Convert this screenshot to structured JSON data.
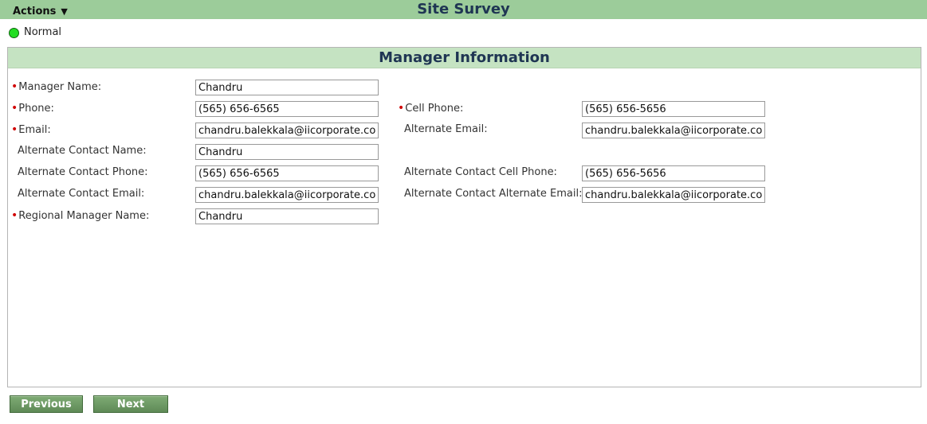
{
  "header": {
    "actions_label": "Actions",
    "actions_caret": "▼",
    "title": "Site Survey"
  },
  "status": {
    "label": "Normal",
    "color": "#22dd22"
  },
  "section": {
    "title": "Manager Information"
  },
  "fields": {
    "manager_name": {
      "label": "Manager Name:",
      "value": "Chandru",
      "required": true
    },
    "phone": {
      "label": "Phone:",
      "value": "(565) 656-6565",
      "required": true
    },
    "cell_phone": {
      "label": "Cell Phone:",
      "value": "(565) 656-5656",
      "required": true
    },
    "email": {
      "label": "Email:",
      "value": "chandru.balekkala@iicorporate.com",
      "required": true
    },
    "alternate_email": {
      "label": "Alternate Email:",
      "value": "chandru.balekkala@iicorporate.com",
      "required": false
    },
    "alt_contact_name": {
      "label": "Alternate Contact Name:",
      "value": "Chandru",
      "required": false
    },
    "alt_contact_phone": {
      "label": "Alternate Contact Phone:",
      "value": "(565) 656-6565",
      "required": false
    },
    "alt_contact_cell_phone": {
      "label": "Alternate Contact Cell Phone:",
      "value": "(565) 656-5656",
      "required": false
    },
    "alt_contact_email": {
      "label": "Alternate Contact Email:",
      "value": "chandru.balekkala@iicorporate.com",
      "required": false
    },
    "alt_contact_alt_email": {
      "label": "Alternate Contact Alternate Email:",
      "value": "chandru.balekkala@iicorporate.com",
      "required": false
    },
    "regional_manager_name": {
      "label": "Regional Manager Name:",
      "value": "Chandru",
      "required": true
    }
  },
  "buttons": {
    "previous": "Previous",
    "next": "Next"
  },
  "colors": {
    "topbar": "#9ccc9a",
    "section_header": "#c5e3c2",
    "title_text": "#1f3553",
    "required_marker": "#d00000",
    "button": "#6b9862"
  }
}
